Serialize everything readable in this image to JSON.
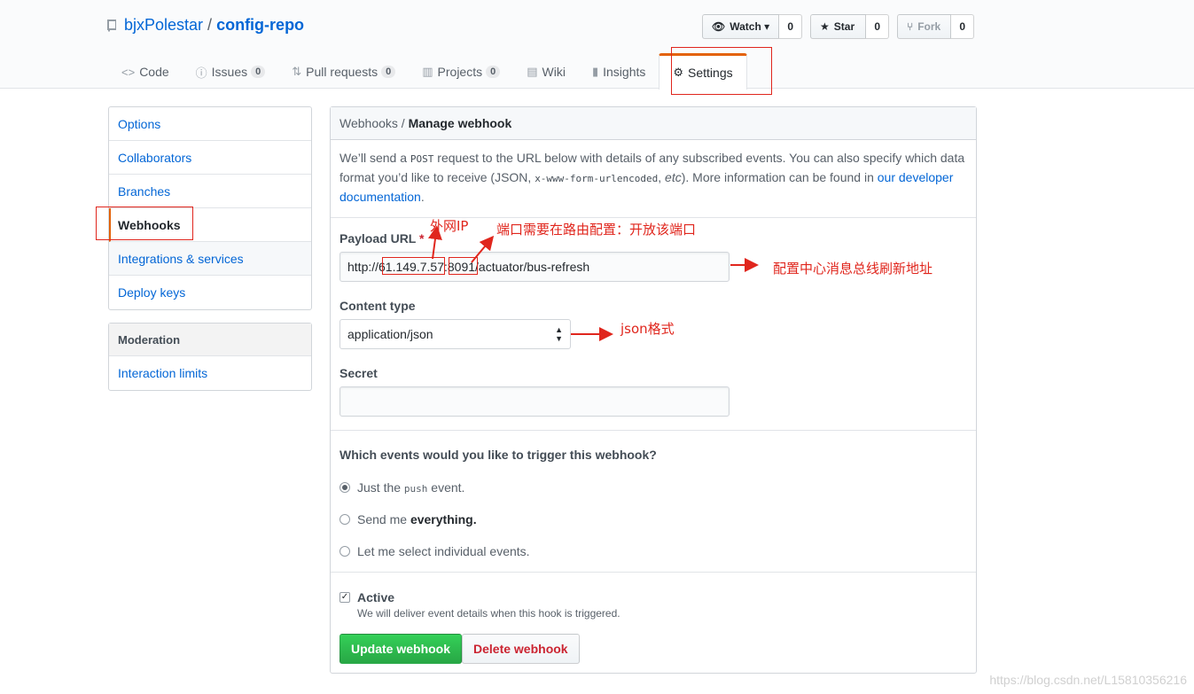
{
  "repo": {
    "owner": "bjxPolestar",
    "separator": "/",
    "name": "config-repo"
  },
  "actions": [
    {
      "icon": "eye-icon",
      "glyph": "👁",
      "label": "Watch ▾",
      "count": "0"
    },
    {
      "icon": "star-icon",
      "glyph": "★",
      "label": "Star",
      "count": "0"
    },
    {
      "icon": "fork-icon",
      "glyph": "⑂",
      "label": "Fork",
      "count": "0"
    }
  ],
  "nav": {
    "code": {
      "label": "Code",
      "glyph": "<>"
    },
    "issues": {
      "label": "Issues",
      "glyph": "ⓘ",
      "count": "0"
    },
    "pulls": {
      "label": "Pull requests",
      "glyph": "⇅",
      "count": "0"
    },
    "projects": {
      "label": "Projects",
      "glyph": "▥",
      "count": "0"
    },
    "wiki": {
      "label": "Wiki",
      "glyph": "▤"
    },
    "insights": {
      "label": "Insights",
      "glyph": "▮"
    },
    "settings": {
      "label": "Settings",
      "glyph": "⚙"
    }
  },
  "sidebar": {
    "items": [
      "Options",
      "Collaborators",
      "Branches",
      "Webhooks",
      "Integrations & services",
      "Deploy keys"
    ],
    "moderation_heading": "Moderation",
    "moderation_items": [
      "Interaction limits"
    ]
  },
  "main": {
    "breadcrumb_parent": "Webhooks",
    "breadcrumb_sep": "/",
    "breadcrumb_current": "Manage webhook",
    "intro_1": "We’ll send a ",
    "intro_code_1": "POST",
    "intro_2": " request to the URL below with details of any subscribed events. You can also specify which data format you’d like to receive (JSON, ",
    "intro_code_2": "x-www-form-urlencoded",
    "intro_3": ", ",
    "intro_etc": "etc",
    "intro_4": "). More information can be found in ",
    "intro_link": "our developer documentation",
    "intro_5": ".",
    "payload_label": "Payload URL",
    "required_mark": "*",
    "payload_value": "http://61.149.7.57:8091/actuator/bus-refresh",
    "content_type_label": "Content type",
    "content_type_value": "application/json",
    "secret_label": "Secret",
    "secret_value": "",
    "events_question": "Which events would you like to trigger this webhook?",
    "event_push_1": "Just the ",
    "event_push_code": "push",
    "event_push_2": " event.",
    "event_all_1": "Send me ",
    "event_all_bold": "everything.",
    "event_select": "Let me select individual events.",
    "active_label": "Active",
    "active_note": "We will deliver event details when this hook is triggered.",
    "update_button": "Update webhook",
    "delete_button": "Delete webhook"
  },
  "annotations": {
    "external_ip": "外网IP",
    "port_note": "端口需要在路由配置：开放该端口",
    "bus_refresh_note": "配置中心消息总线刷新地址",
    "json_note": "json格式"
  },
  "watermark": "https://blog.csdn.net/L15810356216",
  "colors": {
    "accent": "#e36209",
    "link": "#0366d6",
    "annotation": "#e0261d",
    "primary_green": "#28a745",
    "danger": "#cb2431"
  }
}
